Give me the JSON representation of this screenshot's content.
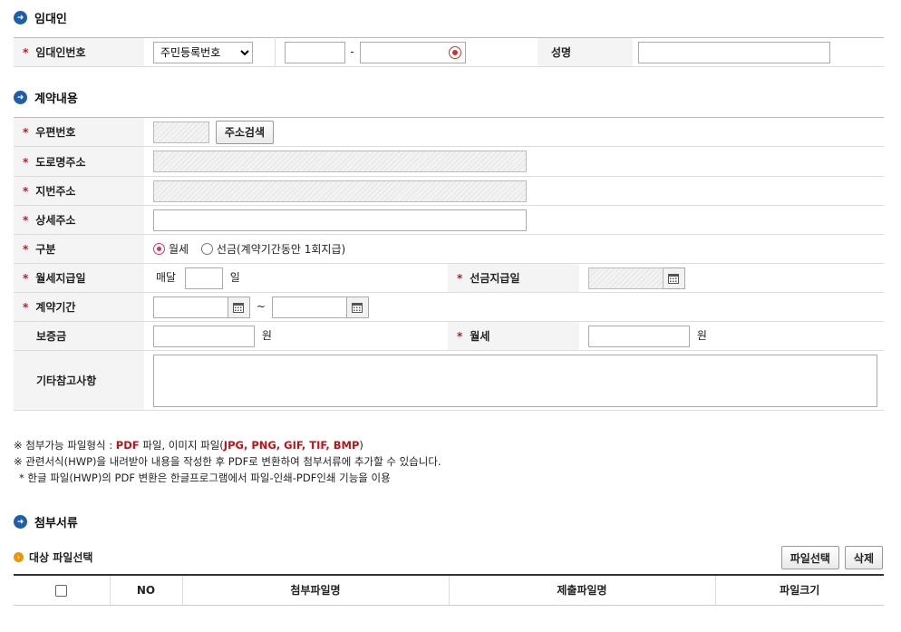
{
  "lessor": {
    "section_title": "임대인",
    "id_number_label": "임대인번호",
    "id_type_selected": "주민등록번호",
    "separator": "-",
    "name_label": "성명"
  },
  "contract": {
    "section_title": "계약내용",
    "postcode_label": "우편번호",
    "address_search_button": "주소검색",
    "road_address_label": "도로명주소",
    "lot_address_label": "지번주소",
    "detail_address_label": "상세주소",
    "type_label": "구분",
    "type_options": [
      "월세",
      "선금(계약기간동안 1회지급)"
    ],
    "type_selected_index": 0,
    "monthly_payday_label": "월세지급일",
    "monthly_prefix": "매달",
    "day_suffix": "일",
    "prepay_date_label": "선금지급일",
    "period_label": "계약기간",
    "period_separator": "~",
    "deposit_label": "보증금",
    "won": "원",
    "monthly_rent_label": "월세",
    "remarks_label": "기타참고사항"
  },
  "notes": {
    "line1_prefix": "※ 첨부가능 파일형식 : ",
    "line1_pdf": "PDF",
    "line1_mid": " 파일, 이미지 파일(",
    "line1_types": "JPG, PNG, GIF, TIF, BMP",
    "line1_suffix": ")",
    "line2": "※ 관련서식(HWP)을 내려받아 내용을 작성한 후 PDF로 변환하여 첨부서류에 추가할 수 있습니다.",
    "line3": "* 한글 파일(HWP)의 PDF 변환은 한글프로그램에서 파일-인쇄-PDF인쇄 기능을 이용"
  },
  "attachments": {
    "section_title": "첨부서류",
    "target_label": "대상 파일선택",
    "select_button": "파일선택",
    "delete_button": "삭제",
    "columns": [
      "NO",
      "첨부파일명",
      "제출파일명",
      "파일크기"
    ]
  },
  "colors": {
    "accent_blue": "#1e5fa8",
    "required_red": "#c0161b",
    "sub_bullet_orange": "#f29400"
  }
}
